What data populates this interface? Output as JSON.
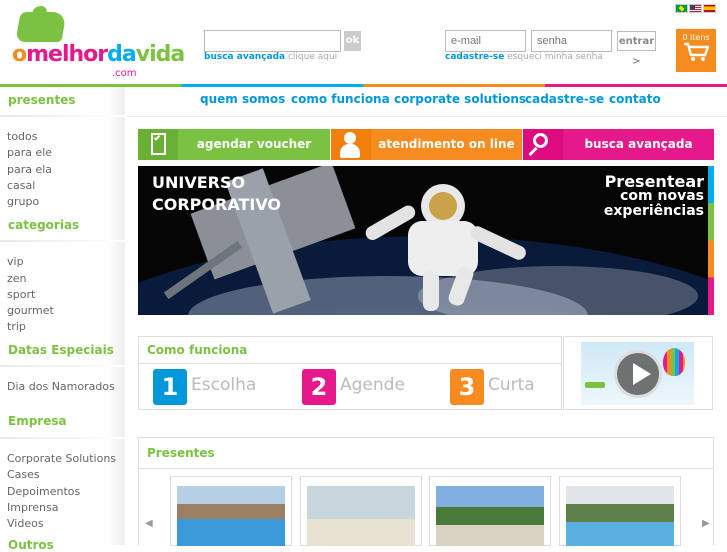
{
  "header": {
    "logo": {
      "o": "o",
      "melhor": "melhor",
      "da": "da",
      "vida": "vida",
      "com": ".com"
    },
    "search": {
      "placeholder": "",
      "ok_label": "ok",
      "advanced_label": "busca avançada",
      "advanced_link": "clique aqui"
    },
    "login": {
      "email_placeholder": "e-mail",
      "password_placeholder": "senha",
      "enter_label": "entrar >",
      "signup_label": "cadastre-se",
      "forgot_label": "esqueci minha senha"
    },
    "cart": {
      "items_label": "0 itens"
    },
    "flags": [
      "brazil-flag-icon",
      "usa-flag-icon",
      "spain-flag-icon"
    ]
  },
  "sidebar": {
    "presentes": {
      "title": "presentes",
      "items": [
        "todos",
        "para ele",
        "para ela",
        "casal",
        "grupo"
      ]
    },
    "categorias": {
      "title": "categorias",
      "items": [
        "vip",
        "zen",
        "sport",
        "gourmet",
        "trip"
      ]
    },
    "datas": {
      "title": "Datas Especiais",
      "items": [
        "Dia dos Namorados"
      ]
    },
    "empresa": {
      "title": "Empresa",
      "items": [
        "Corporate Solutions",
        "Cases",
        "Depoimentos",
        "Imprensa",
        "Videos"
      ]
    },
    "outros": {
      "title": "Outros"
    }
  },
  "nav": [
    "quem somos",
    "como funciona",
    "corporate solutions",
    "cadastre-se",
    "contato"
  ],
  "actions": [
    {
      "label": "agendar voucher",
      "color": "#7cc242",
      "icon": "voucher-icon"
    },
    {
      "label": "atendimento on line",
      "color": "#f68b1f",
      "icon": "person-icon"
    },
    {
      "label": "busca avançada",
      "color": "#e6198c",
      "icon": "magnifier-icon"
    }
  ],
  "banner": {
    "left_line1": "UNIVERSO",
    "left_line2": "CORPORATIVO",
    "right_line1": "Presentear",
    "right_line2": "com novas",
    "right_line3": "experiências"
  },
  "como_funciona": {
    "title": "Como funciona",
    "steps": [
      {
        "num": "1",
        "label": "Escolha",
        "color": "#0098da"
      },
      {
        "num": "2",
        "label": "Agende",
        "color": "#e6198c"
      },
      {
        "num": "3",
        "label": "Curta",
        "color": "#f68b1f"
      }
    ]
  },
  "presentes_section": {
    "title": "Presentes",
    "prev": "◀",
    "next": "▶"
  },
  "colors": {
    "green": "#7cc242",
    "blue": "#0098da",
    "orange": "#f68b1f",
    "pink": "#e6198c"
  }
}
